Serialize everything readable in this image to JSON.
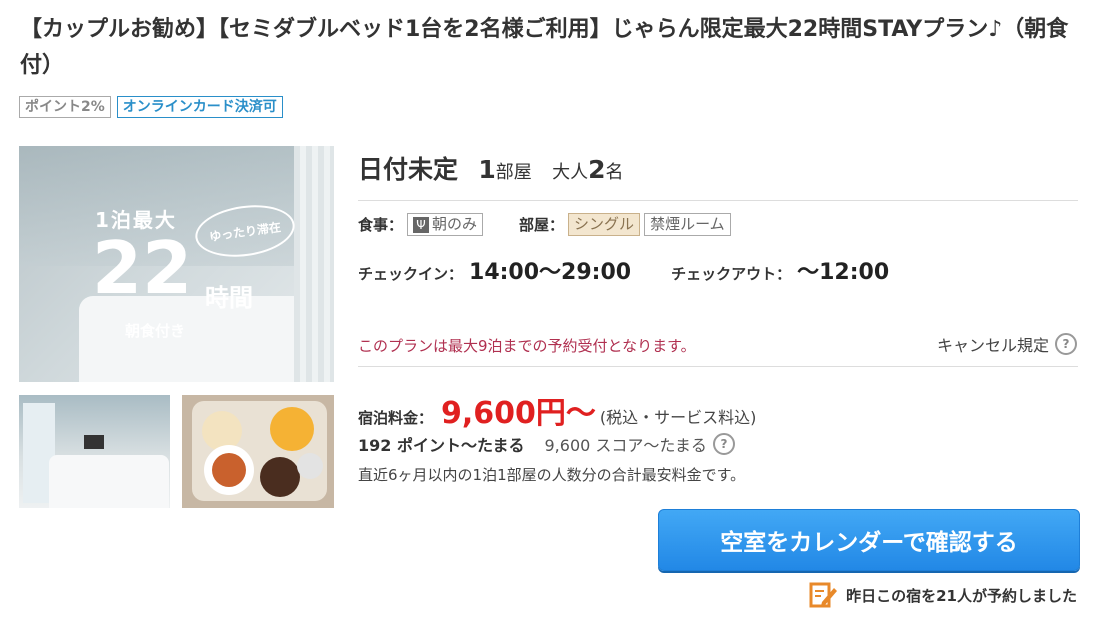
{
  "plan": {
    "title": "【カップルお勧め】【セミダブルベッド1台を2名様ご利用】じゃらん限定最大22時間STAYプラン♪（朝食付）",
    "tags": [
      "ポイント2%",
      "オンラインカード決済可"
    ]
  },
  "image": {
    "overlay_top": "1泊最大",
    "overlay_bubble": "ゆったり滞在",
    "overlay_big": "22",
    "overlay_hours": "時間",
    "overlay_breakfast": "朝食付き"
  },
  "booking": {
    "date": "日付未定",
    "rooms_num": "1",
    "rooms_unit": "部屋",
    "adults_label": "大人",
    "adults_num": "2",
    "adults_unit": "名"
  },
  "details": {
    "meal_label": "食事：",
    "meal_value": "朝のみ",
    "room_label": "部屋：",
    "room_type": "シングル",
    "room_smoking": "禁煙ルーム",
    "checkin_label": "チェックイン：",
    "checkin_value": "14:00〜29:00",
    "checkout_label": "チェックアウト：",
    "checkout_value": "〜12:00",
    "notice": "このプランは最大9泊までの予約受付となります。",
    "cancel_policy": "キャンセル規定"
  },
  "pricing": {
    "label": "宿泊料金：",
    "value": "9,600円〜",
    "note": "(税込・サービス料込)",
    "points": "192 ポイント〜たまる",
    "score": "9,600 スコア〜たまる",
    "description": "直近6ヶ月以内の1泊1部屋の人数分の合計最安料金です。"
  },
  "actions": {
    "calendar_button": "空室をカレンダーで確認する",
    "booked_text": "昨日この宿を21人が予約しました"
  },
  "colors": {
    "price": "#e02020",
    "button": "#2288e6",
    "notice": "#b03050",
    "tag_blue": "#2a8fc9"
  }
}
